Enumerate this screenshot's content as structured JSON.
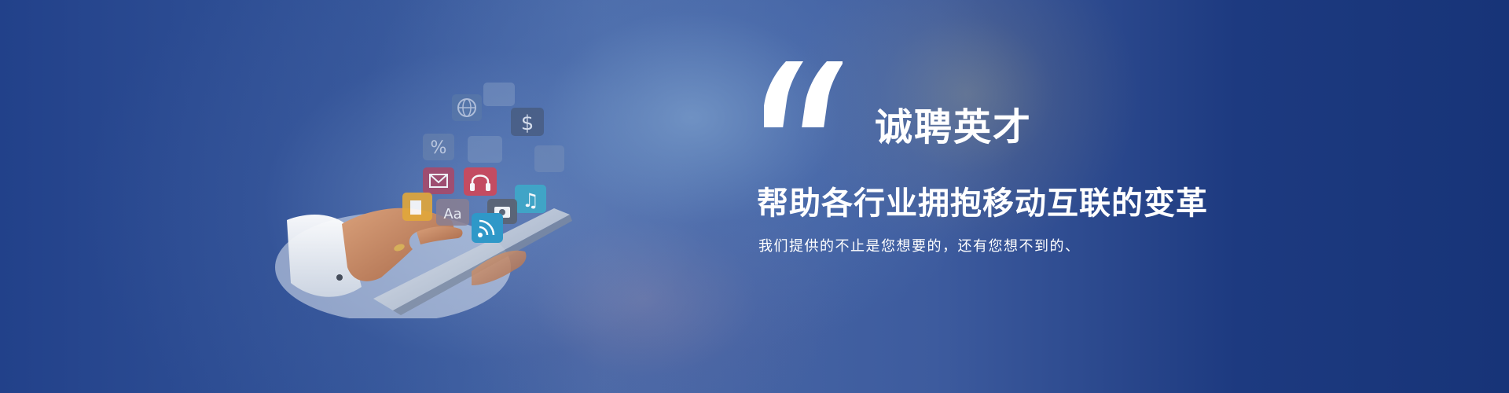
{
  "banner": {
    "headline": "诚聘英才",
    "subheadline": "帮助各行业拥抱移动互联的变革",
    "tagline": "我们提供的不止是您想要的，还有您想不到的、"
  },
  "illustration": {
    "icons": [
      {
        "name": "globe-icon",
        "glyph": "🌐"
      },
      {
        "name": "dollar-icon",
        "glyph": "$"
      },
      {
        "name": "percent-icon",
        "glyph": "%"
      },
      {
        "name": "mail-icon",
        "glyph": "✉"
      },
      {
        "name": "headphones-icon",
        "glyph": "🎧"
      },
      {
        "name": "font-icon",
        "glyph": "Aa"
      },
      {
        "name": "music-icon",
        "glyph": "♫"
      },
      {
        "name": "camera-icon",
        "glyph": "📷"
      },
      {
        "name": "rss-icon",
        "glyph": "((•"
      },
      {
        "name": "document-icon",
        "glyph": "▮"
      }
    ]
  },
  "colors": {
    "background_dark": "#173478",
    "background_mid": "#4a6aa8",
    "text": "#ffffff"
  }
}
